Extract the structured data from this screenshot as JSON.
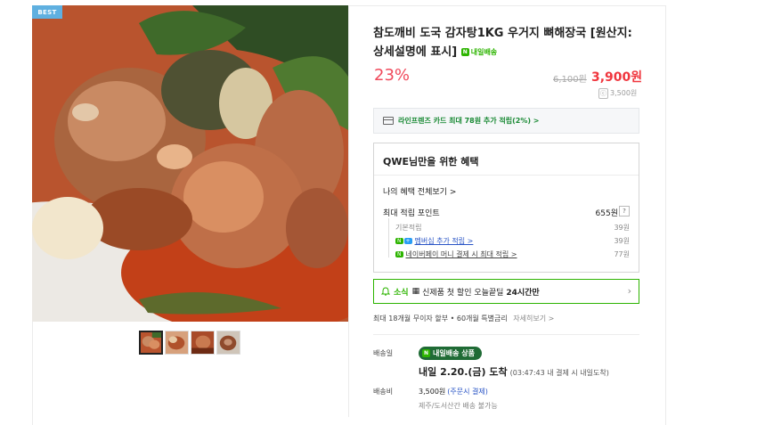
{
  "badge": {
    "best": "BEST"
  },
  "product": {
    "title": "참도깨비 도국 감자탕1KG 우거지 뼈해장국 [원산지: 상세설명에 표시]",
    "delivery_tag": "내일배송",
    "discount": "23%",
    "original_price": "6,100원",
    "sale_price": "3,900원",
    "cashback": "3,500원"
  },
  "card_promo": {
    "text": "라인프렌즈 카드 최대 78원 추가 적립(2%) >"
  },
  "benefits": {
    "title": "QWE님만을 위한 혜택",
    "view_all": "나의 혜택 전체보기 >",
    "max_point_label": "최대 적립 포인트",
    "max_point_value": "655원",
    "help": "?",
    "rows": [
      {
        "label": "기본적립",
        "value": "39원"
      },
      {
        "label": "멤버십 추가 적립 >",
        "value": "39원"
      },
      {
        "label": "네이버페이 머니 결제 시 최대 적립 >",
        "value": "77원"
      }
    ],
    "badges": {
      "n": "N",
      "plus": "+",
      "pay": "N"
    }
  },
  "coupon": {
    "tag": "소식",
    "text_pre": "신제품 첫 할인 오늘끝딜",
    "text_strong": "24시간만",
    "icon_text": "▦"
  },
  "installment": {
    "text": "최대 18개월 무이자 할부 • 60개월 특별금리",
    "more": "자세히보기 >"
  },
  "shipping": {
    "label_date": "배송일",
    "badge": "내일배송 상품",
    "arrival": "내일 2.20.(금) 도착",
    "arrival_note": "(03:47:43 내 결제 시 내일도착)",
    "label_fee": "배송비",
    "fee": "3,500원",
    "fee_condition": "(주문시 결제)",
    "fee_note": "제주/도서산간 배송 불가능"
  },
  "colors": {
    "accent_red": "#f0363e",
    "discount_pink": "#f04a5c",
    "naver_green": "#2db400",
    "dark_green": "#1f6b35"
  },
  "icons": [
    "card-icon",
    "bell-icon",
    "chevron-right-icon",
    "question-icon"
  ]
}
